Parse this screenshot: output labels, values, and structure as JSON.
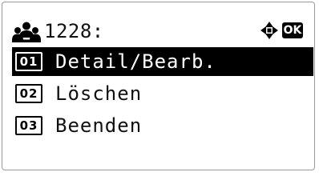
{
  "header": {
    "icon": "users-icon",
    "title": "1228:"
  },
  "nav": {
    "arrows_icon": "four-way-arrows-icon",
    "ok_label": "OK"
  },
  "menu": {
    "items": [
      {
        "number": "01",
        "label": "Detail/Bearb.",
        "selected": true
      },
      {
        "number": "02",
        "label": "Löschen",
        "selected": false
      },
      {
        "number": "03",
        "label": "Beenden",
        "selected": false
      }
    ]
  },
  "colors": {
    "selected_bg": "#000000",
    "selected_fg": "#ffffff",
    "text": "#111111",
    "frame": "#9a9a9a"
  }
}
